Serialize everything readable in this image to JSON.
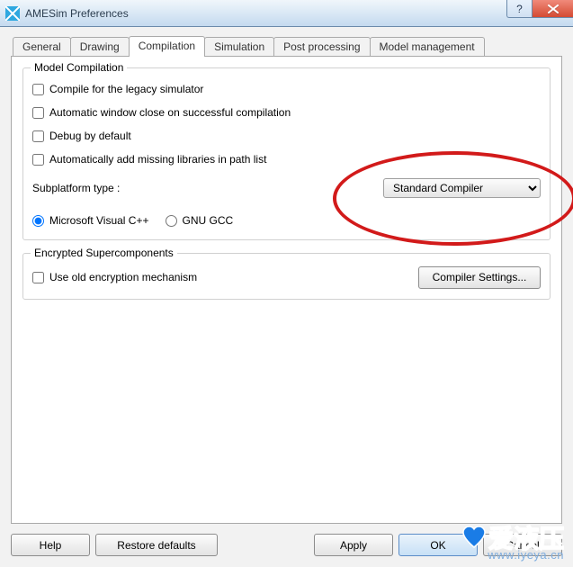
{
  "titlebar": {
    "title": "AMESim Preferences",
    "help_symbol": "?",
    "close_symbol": "×"
  },
  "tabs": {
    "general": "General",
    "drawing": "Drawing",
    "compilation": "Compilation",
    "simulation": "Simulation",
    "post_processing": "Post processing",
    "model_management": "Model management",
    "active": "compilation"
  },
  "group_model": {
    "legend": "Model Compilation",
    "checkboxes": {
      "legacy": "Compile for the legacy simulator",
      "auto_close": "Automatic window close on successful compilation",
      "debug": "Debug by default",
      "auto_libs": "Automatically add missing libraries in path list"
    },
    "subplatform_label": "Subplatform type :",
    "subplatform_value": "Standard Compiler",
    "radios": {
      "msvc": "Microsoft Visual C++",
      "gcc": "GNU GCC"
    }
  },
  "group_enc": {
    "legend": "Encrypted Supercomponents",
    "old_enc": "Use old encryption mechanism",
    "compiler_settings": "Compiler Settings..."
  },
  "buttons": {
    "help": "Help",
    "restore": "Restore defaults",
    "apply": "Apply",
    "ok": "OK",
    "cancel": "Cancel"
  },
  "watermark": {
    "main": "爱液压",
    "sub": "www.iyeya.cn"
  },
  "colors": {
    "annotation": "#d21a1a",
    "watermark": "#1a7ce6"
  }
}
